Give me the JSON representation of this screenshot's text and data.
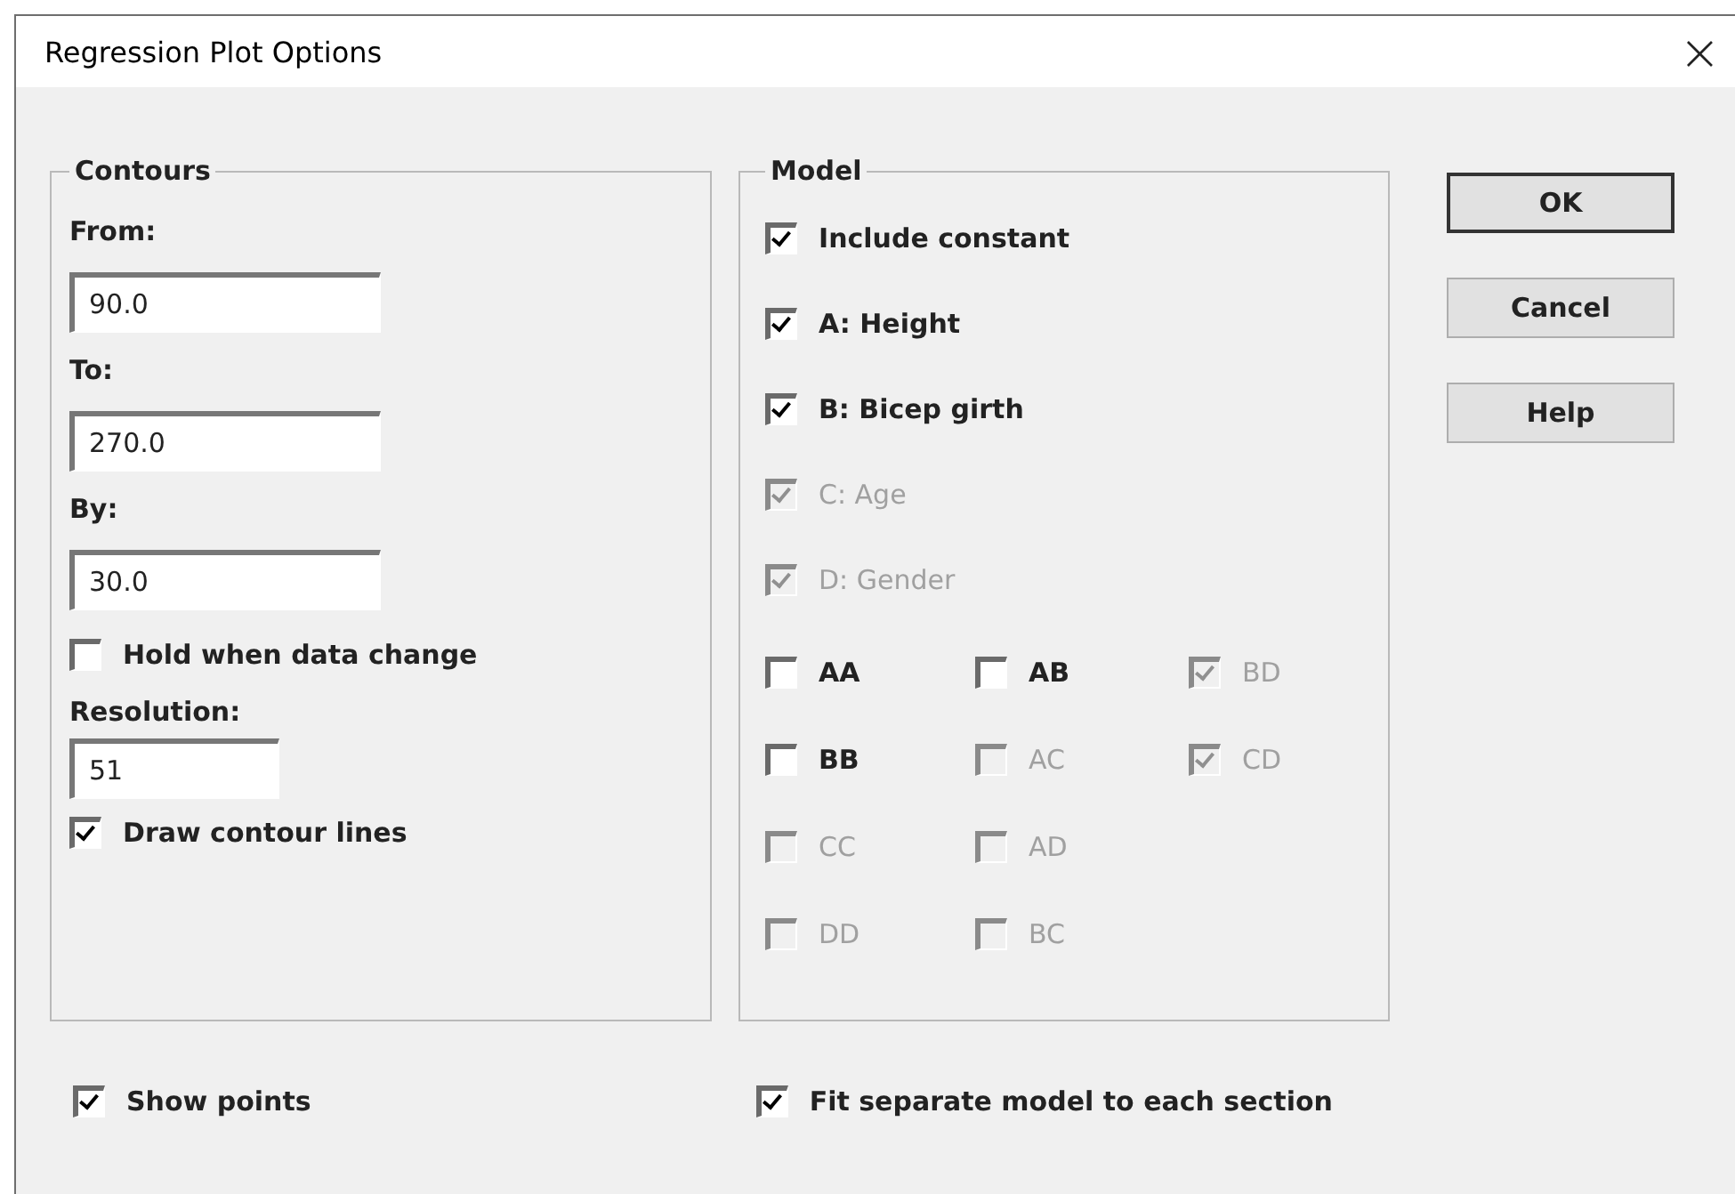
{
  "window": {
    "title": "Regression Plot Options",
    "close": "×"
  },
  "contours": {
    "title": "Contours",
    "fields": [
      {
        "label": "From:",
        "value": "90.0"
      },
      {
        "label": "To:",
        "value": "270.0"
      },
      {
        "label": "By:",
        "value": "30.0"
      }
    ],
    "hold": {
      "label": "Hold when data change",
      "checked": false
    },
    "resolution": {
      "label": "Resolution:",
      "value": "51"
    },
    "draw_lines": {
      "label": "Draw contour lines",
      "checked": true
    }
  },
  "model": {
    "title": "Model",
    "main": [
      {
        "label": "Include constant",
        "checked": true,
        "disabled": false
      },
      {
        "label": "A: Height",
        "checked": true,
        "disabled": false
      },
      {
        "label": "B: Bicep girth",
        "checked": true,
        "disabled": false
      },
      {
        "label": "C: Age",
        "checked": true,
        "disabled": true
      },
      {
        "label": "D: Gender",
        "checked": true,
        "disabled": true
      }
    ],
    "terms": [
      {
        "label": "AA",
        "checked": false,
        "disabled": false
      },
      {
        "label": "BB",
        "checked": false,
        "disabled": false
      },
      {
        "label": "CC",
        "checked": false,
        "disabled": true
      },
      {
        "label": "DD",
        "checked": false,
        "disabled": true
      },
      {
        "label": "AB",
        "checked": false,
        "disabled": false
      },
      {
        "label": "AC",
        "checked": false,
        "disabled": true
      },
      {
        "label": "AD",
        "checked": false,
        "disabled": true
      },
      {
        "label": "BC",
        "checked": false,
        "disabled": true
      },
      {
        "label": "BD",
        "checked": true,
        "disabled": true
      },
      {
        "label": "CD",
        "checked": true,
        "disabled": true
      }
    ]
  },
  "buttons": [
    {
      "label": "OK",
      "default": true
    },
    {
      "label": "Cancel",
      "default": false
    },
    {
      "label": "Help",
      "default": false
    }
  ],
  "show_points": {
    "label": "Show points",
    "checked": true
  },
  "fit_separate": {
    "label": "Fit separate model to each section",
    "checked": true
  }
}
